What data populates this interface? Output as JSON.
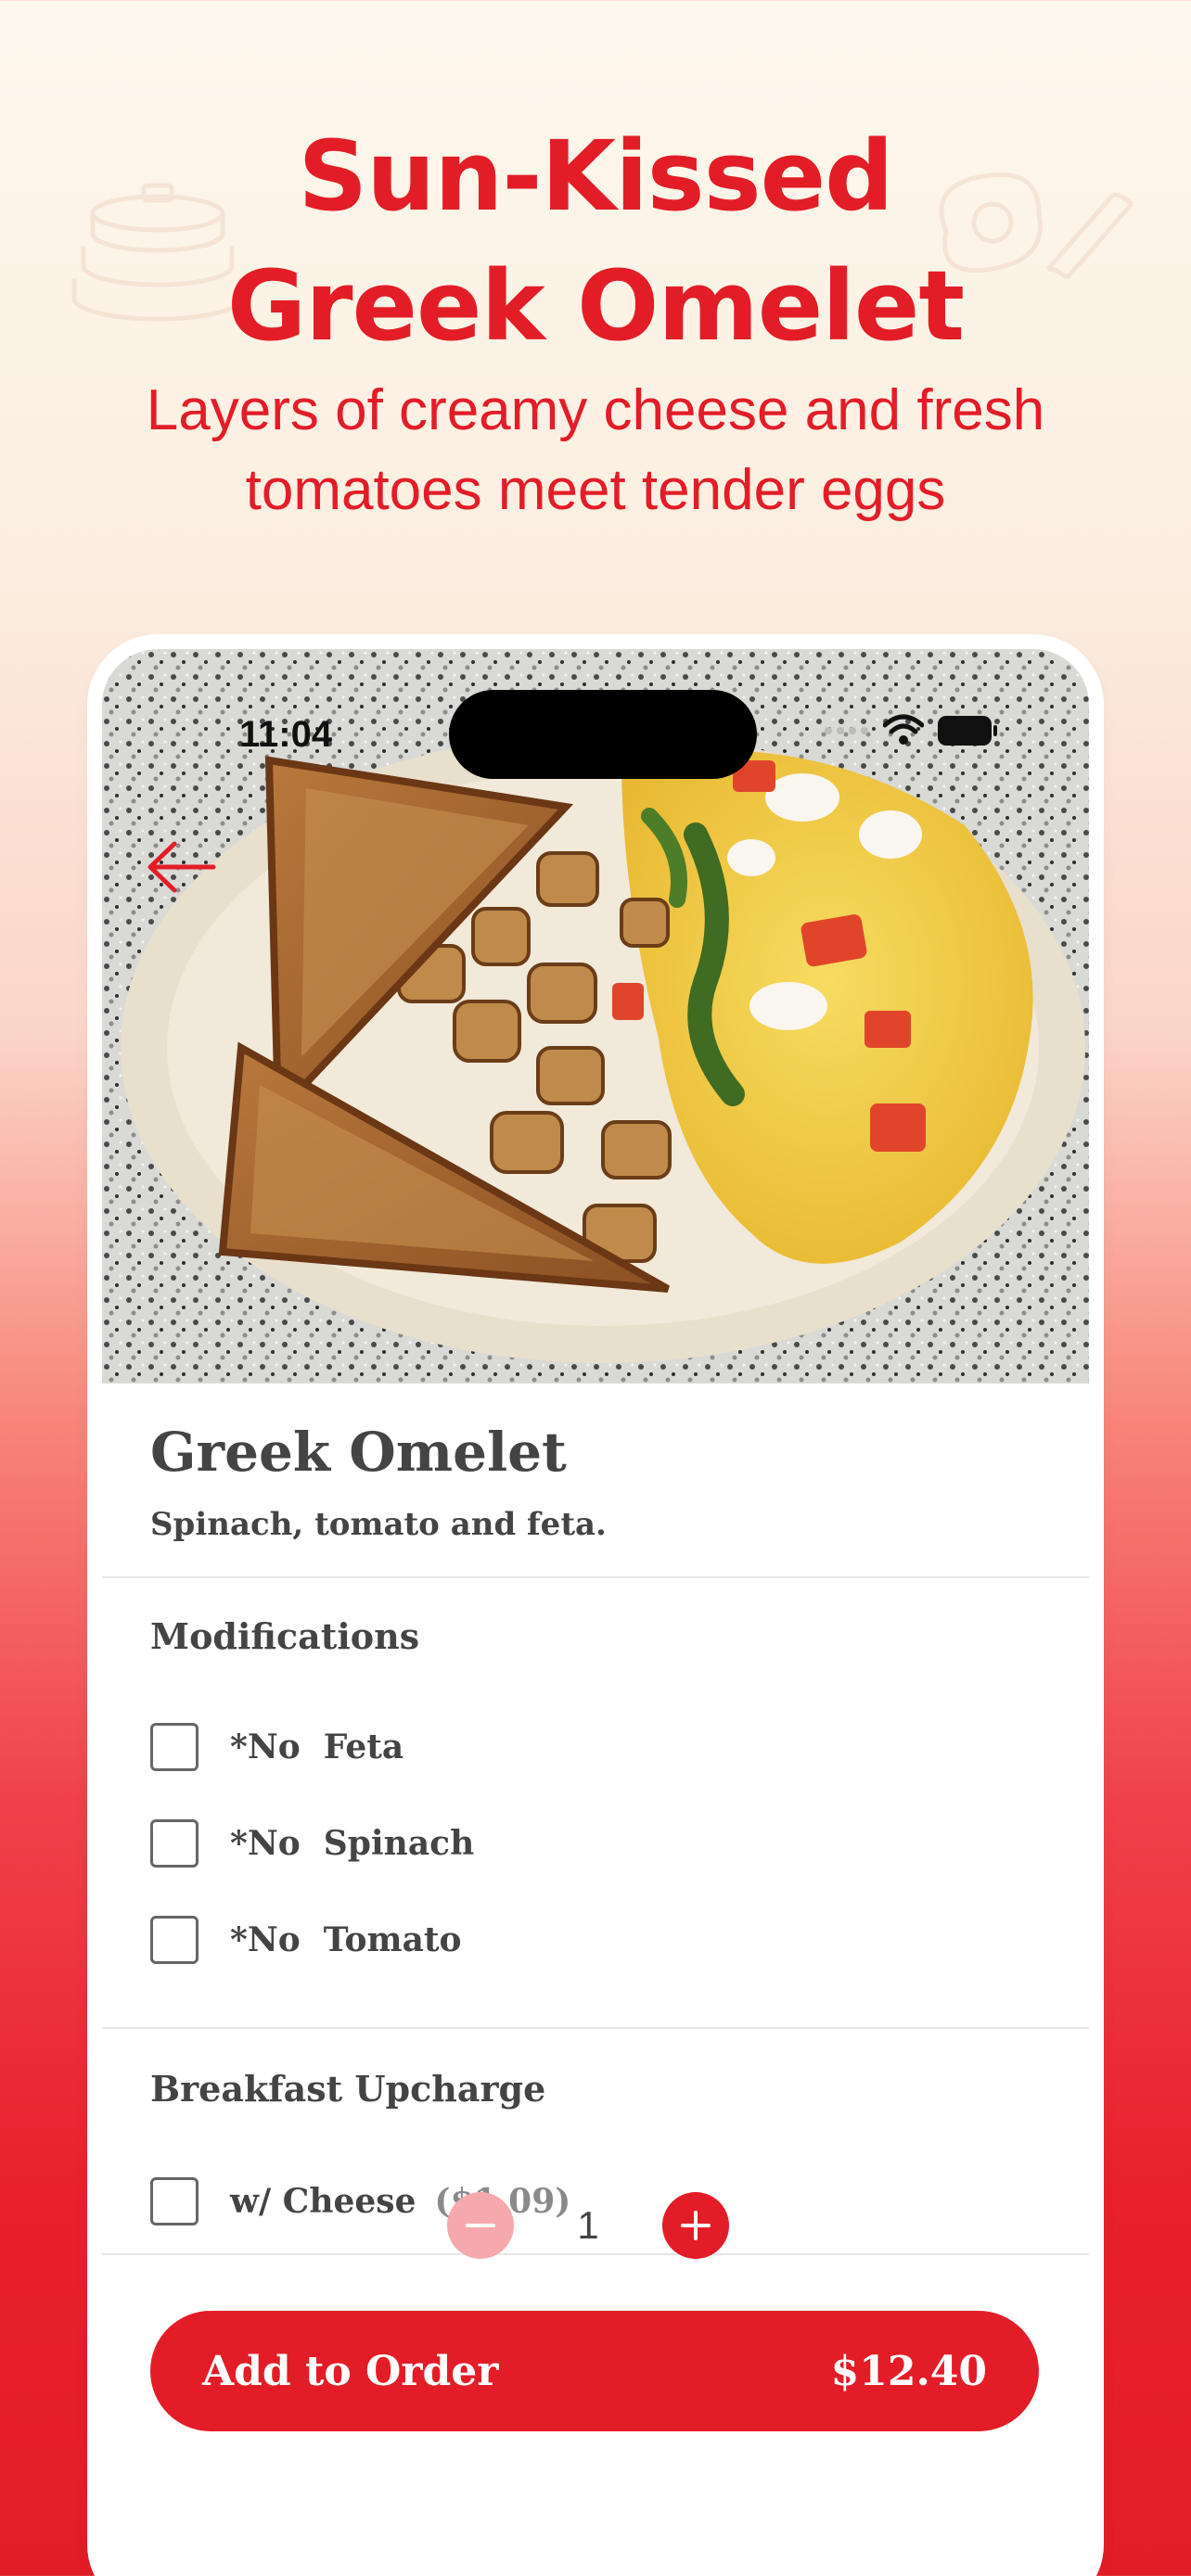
{
  "hero": {
    "title_line1": "Sun-Kissed",
    "title_line2": "Greek Omelet",
    "subtitle_line1": "Layers of creamy cheese and fresh",
    "subtitle_line2": "tomatoes meet tender eggs"
  },
  "status_bar": {
    "time": "11:04"
  },
  "item": {
    "name": "Greek Omelet",
    "description": "Spinach, tomato and feta."
  },
  "modifications": {
    "title": "Modifications",
    "options": [
      {
        "label": "*No  Feta",
        "checked": false
      },
      {
        "label": "*No  Spinach",
        "checked": false
      },
      {
        "label": "*No  Tomato",
        "checked": false
      }
    ]
  },
  "upcharge": {
    "title": "Breakfast Upcharge",
    "options": [
      {
        "label": "w/ Cheese",
        "price": "($1.09)",
        "checked": false
      }
    ]
  },
  "quantity": {
    "value": "1",
    "minus_icon": "minus-icon",
    "plus_icon": "plus-icon"
  },
  "add_to_order": {
    "label": "Add to Order",
    "price": "$12.40"
  },
  "colors": {
    "accent": "#e31d27",
    "accent_light": "#f6a9ad",
    "text_dark": "#444444",
    "text_muted": "#8a8a8a"
  }
}
